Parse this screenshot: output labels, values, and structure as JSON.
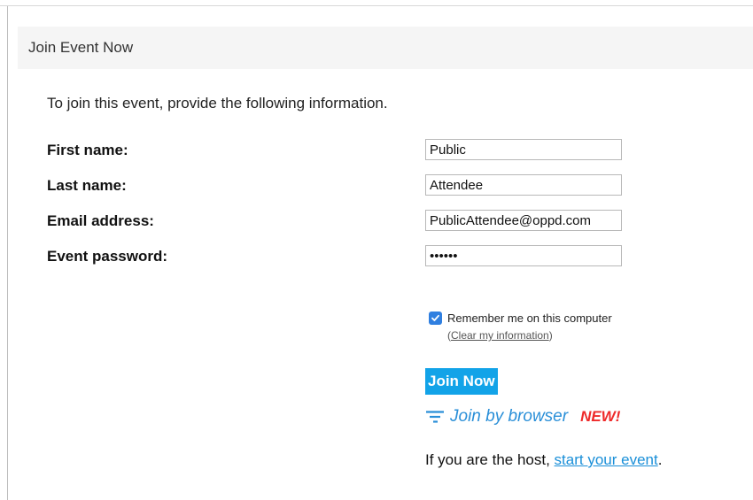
{
  "header": {
    "title": "Join Event Now"
  },
  "intro": "To join this event, provide the following information.",
  "form": {
    "first_name": {
      "label": "First name:",
      "value": "Public"
    },
    "last_name": {
      "label": "Last name:",
      "value": "Attendee"
    },
    "email": {
      "label": "Email address:",
      "value": "PublicAttendee@oppd.com"
    },
    "password": {
      "label": "Event password:",
      "value": "••••••"
    }
  },
  "remember": {
    "checked": true,
    "label": "Remember me on this computer",
    "clear_open": "(",
    "clear_link": "Clear my information",
    "clear_close": ")"
  },
  "join_button": "Join Now",
  "browser": {
    "label": "Join by browser",
    "badge": "NEW!"
  },
  "host": {
    "prefix": "If you are the host, ",
    "link": "start your event",
    "suffix": "."
  },
  "colors": {
    "accent": "#12a3e8",
    "link": "#1a8fd8",
    "new_badge": "#ee2a2a",
    "checkbox": "#2f7fe0"
  }
}
